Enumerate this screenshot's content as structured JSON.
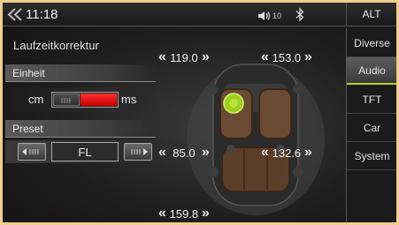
{
  "header": {
    "time": "11:18",
    "volume_level": "10",
    "alt_label": "ALT"
  },
  "panel": {
    "title": "Laufzeitkorrektur",
    "unit_section_label": "Einheit",
    "unit_left": "cm",
    "unit_right": "ms",
    "unit_selected": "ms",
    "preset_section_label": "Preset",
    "preset_value": "FL"
  },
  "speakers": {
    "front_left": "119.0",
    "front_right": "153.0",
    "rear_left": "85.0",
    "rear_right": "132.6",
    "subwoofer": "159.8",
    "decrease_symbol": "«",
    "increase_symbol": "»"
  },
  "sidebar": {
    "items": [
      {
        "label": "Diverse"
      },
      {
        "label": "Audio"
      },
      {
        "label": "TFT"
      },
      {
        "label": "Car"
      },
      {
        "label": "System"
      }
    ],
    "active_index": 1
  },
  "colors": {
    "accent": "#b8d12a",
    "toggle_red": "#e31b1b",
    "listening_position": "#9ccf1e"
  },
  "icons": [
    "back-arrow-icon",
    "volume-icon",
    "bluetooth-icon",
    "car-top-view-icon",
    "listening-position-icon",
    "preset-prev-icon",
    "preset-next-icon"
  ]
}
